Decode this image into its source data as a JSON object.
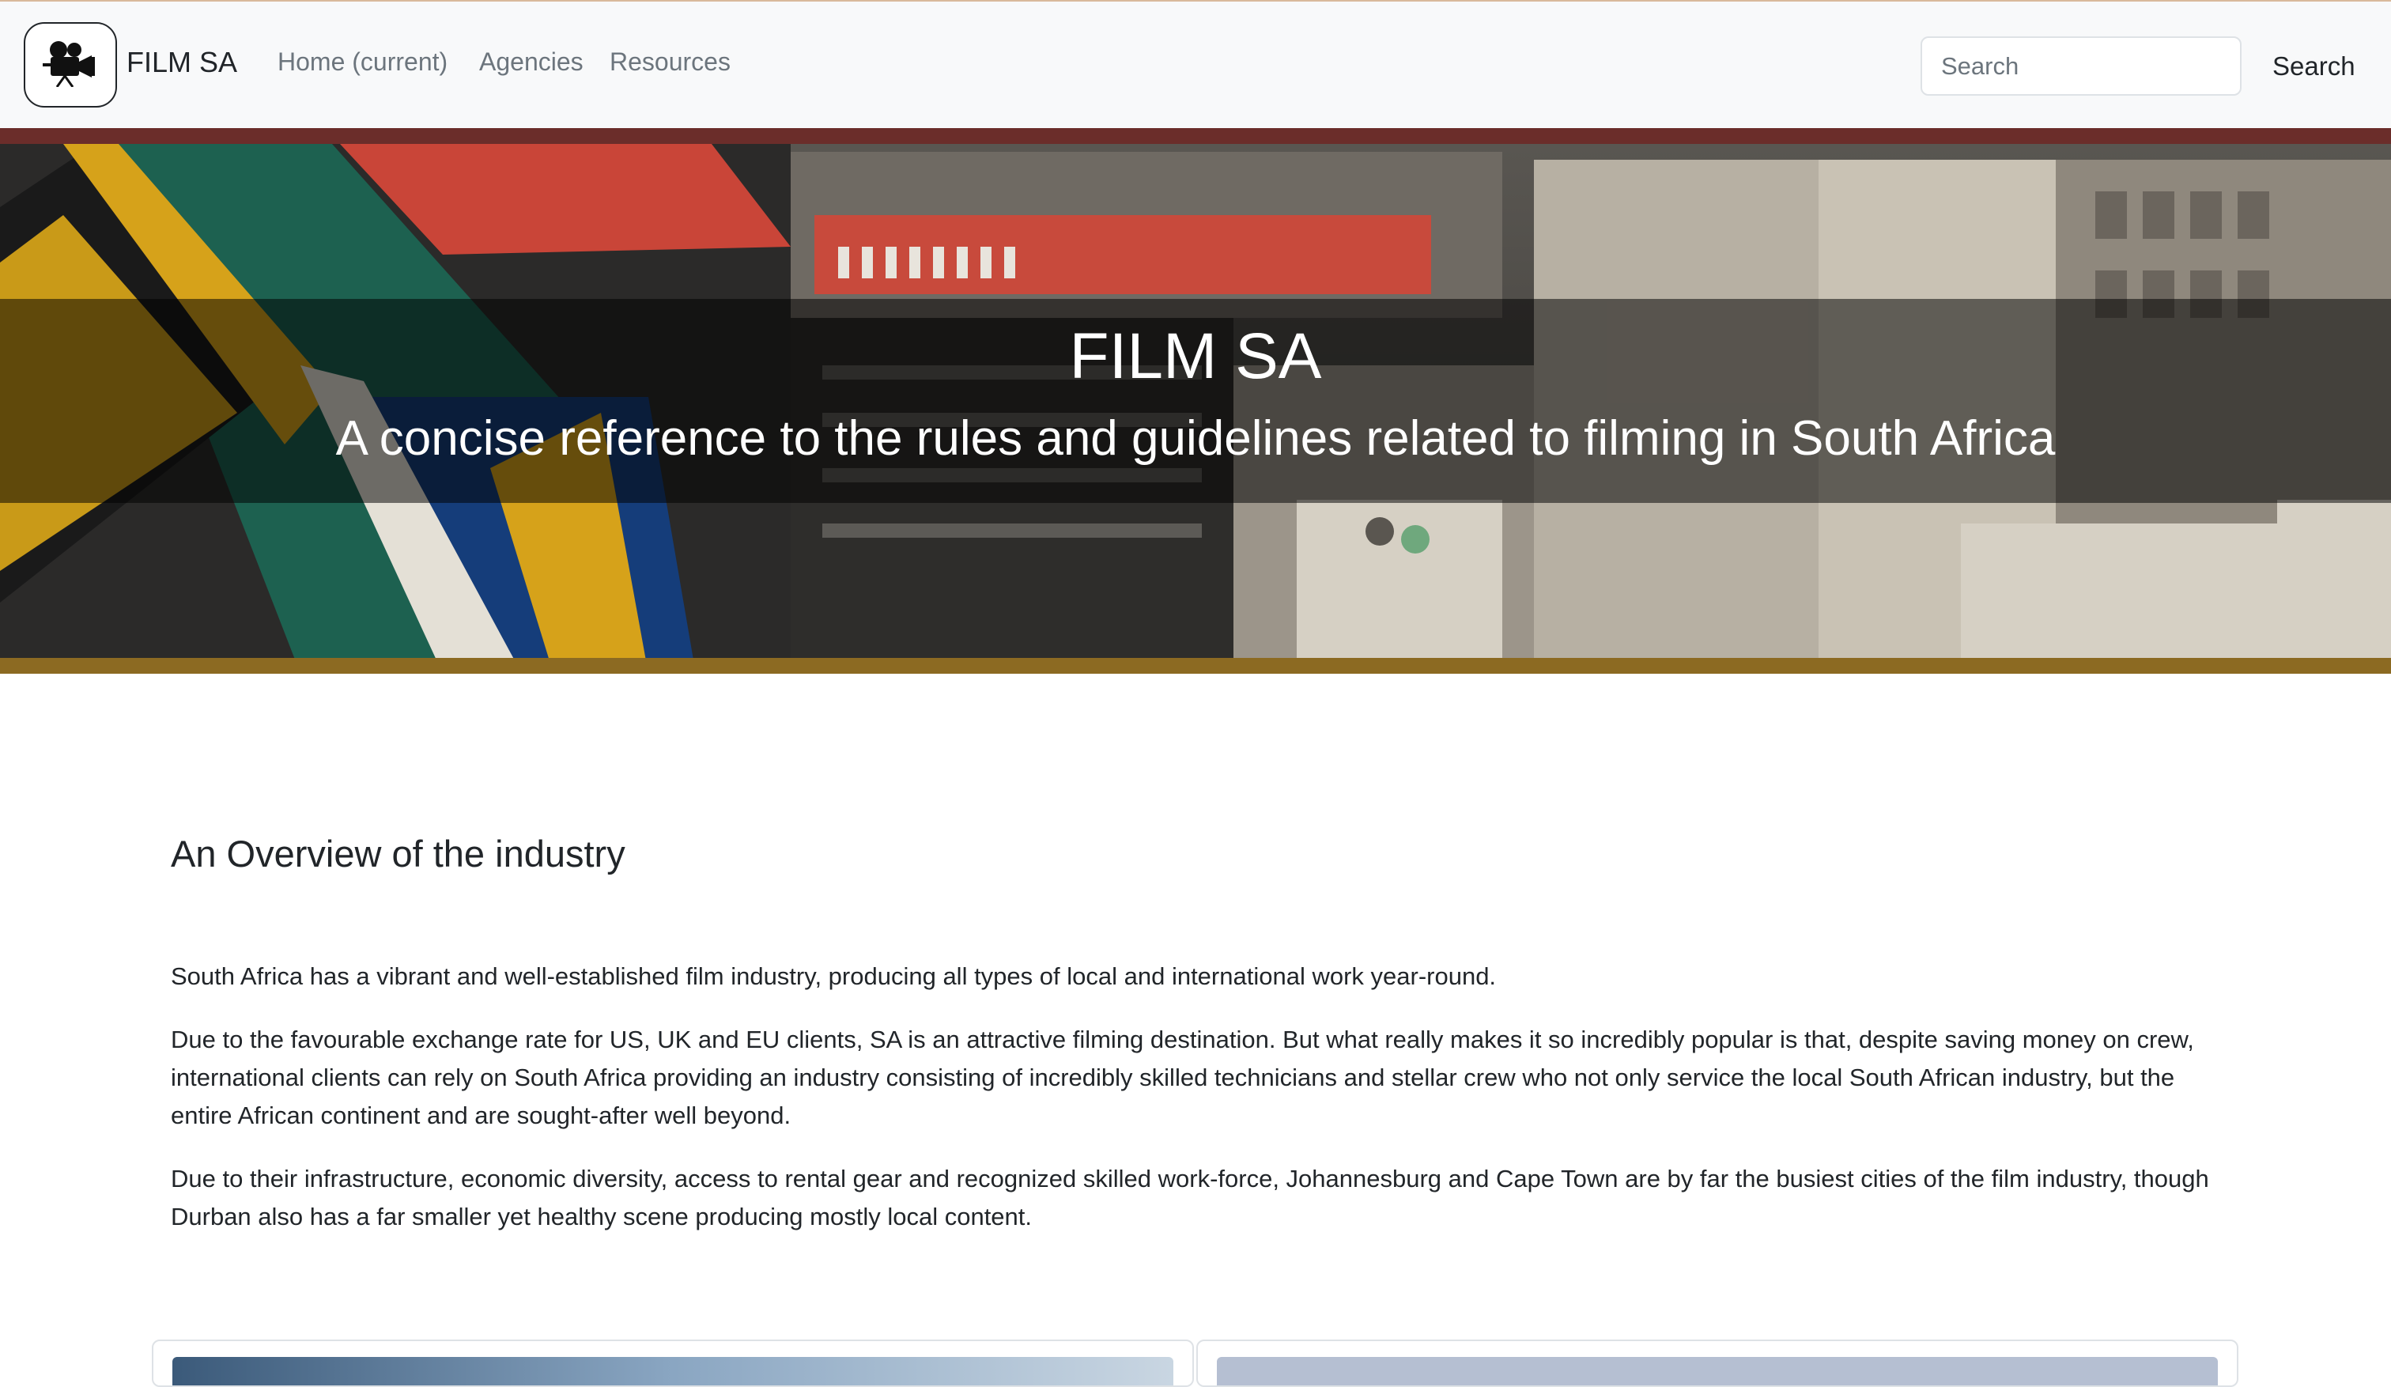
{
  "navbar": {
    "logo_icon": "film-camera-icon",
    "brand": "FILM SA",
    "links": [
      "Home (current)",
      "Agencies",
      "Resources"
    ],
    "search": {
      "placeholder": "Search",
      "value": "",
      "button_label": "Search"
    }
  },
  "hero": {
    "title": "FILM SA",
    "subtitle": "A concise reference to the rules and guidelines related to filming in South Africa"
  },
  "overview": {
    "heading": "An Overview of the industry",
    "paragraphs": [
      "South Africa has a vibrant and well-established film industry, producing all types of local and international work year-round.",
      "Due to the favourable exchange rate for US, UK and EU clients, SA is an attractive filming destination. But what really makes it so incredibly popular is that, despite saving money on crew, international clients can rely on South Africa providing an industry consisting of incredibly skilled technicians and stellar crew who not only service the local South African industry, but the entire African continent and are sought-after well beyond.",
      "Due to their infrastructure, economic diversity, access to rental gear and recognized skilled work-force, Johannesburg and Cape Town are by far the busiest cities of the film industry, though Durban also has a far smaller yet healthy scene producing mostly local content."
    ]
  },
  "colors": {
    "navbar_bg": "#f8f9fa",
    "hero_top_border": "#6b2d2a",
    "hero_bottom_border": "#8c6a22",
    "text": "#212529",
    "muted_link": "#6c757d"
  }
}
